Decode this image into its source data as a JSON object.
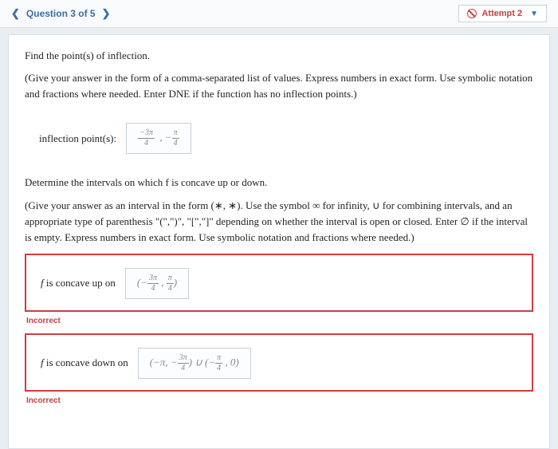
{
  "nav": {
    "question_label": "Question 3 of 5"
  },
  "attempt": {
    "label": "Attempt 2"
  },
  "q1": {
    "prompt": "Find the point(s) of inflection.",
    "hint": "(Give your answer in the form of a comma-separated list of values. Express numbers in exact form. Use symbolic notation and fractions where needed. Enter DNE if the function has no inflection points.)",
    "label": "inflection point(s):",
    "answer": "−3π⁄4 , −π⁄4"
  },
  "q2": {
    "prompt": "Determine the intervals on which  f  is concave up or down.",
    "hint": "(Give your answer as an interval in the form (∗, ∗). Use the symbol ∞ for infinity, ∪ for combining intervals, and an appropriate type of parenthesis \"(\",\")\", \"[\",\"]\" depending on whether the interval is open or closed. Enter ∅ if the interval is empty. Express numbers in exact form. Use symbolic notation and fractions where needed.)"
  },
  "up": {
    "label_pre": "f ",
    "label": " is concave up on",
    "answer": "( −3π⁄4 , π⁄4 )",
    "status": "Incorrect"
  },
  "down": {
    "label_pre": "f ",
    "label": " is concave down on",
    "answer": "( −π, −3π⁄4 ) ∪ ( −π⁄4 , 0 )",
    "status": "Incorrect"
  }
}
